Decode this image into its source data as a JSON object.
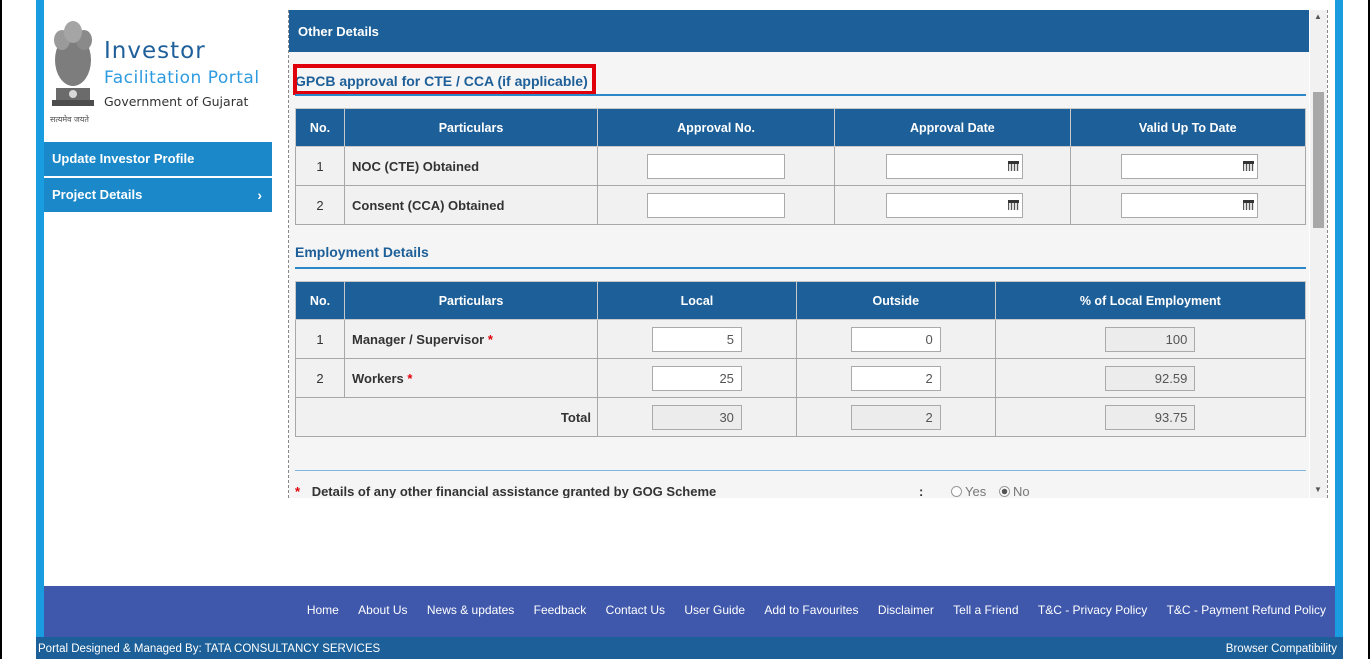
{
  "logo": {
    "line1": "Investor",
    "line2": "Facilitation Portal",
    "line3": "Government of Gujarat",
    "motto": "सत्यमेव जयते"
  },
  "sidebar": {
    "items": [
      {
        "label": "Update Investor Profile",
        "chevron": ""
      },
      {
        "label": "Project Details",
        "chevron": "›"
      }
    ]
  },
  "panel": {
    "title": "Other Details",
    "gpcb": {
      "title": "GPCB approval for CTE / CCA (if applicable)",
      "headers": [
        "No.",
        "Particulars",
        "Approval No.",
        "Approval Date",
        "Valid Up To Date"
      ],
      "rows": [
        {
          "no": "1",
          "label": "NOC (CTE) Obtained",
          "approval_no": "",
          "approval_date": "",
          "valid_date": ""
        },
        {
          "no": "2",
          "label": "Consent (CCA) Obtained",
          "approval_no": "",
          "approval_date": "",
          "valid_date": ""
        }
      ]
    },
    "employment": {
      "title": "Employment Details",
      "headers": [
        "No.",
        "Particulars",
        "Local",
        "Outside",
        "% of Local Employment"
      ],
      "rows": [
        {
          "no": "1",
          "label": "Manager / Supervisor",
          "local": "5",
          "outside": "0",
          "pct": "100"
        },
        {
          "no": "2",
          "label": "Workers",
          "local": "25",
          "outside": "2",
          "pct": "92.59"
        }
      ],
      "total": {
        "label": "Total",
        "local": "30",
        "outside": "2",
        "pct": "93.75"
      },
      "required_mark": "*"
    },
    "financial": {
      "star": "*",
      "label": "Details of any other financial assistance granted by GOG Scheme",
      "colon": ":",
      "yes": "Yes",
      "no": "No",
      "selected": "No"
    }
  },
  "footer": {
    "links": [
      "Home",
      "About Us",
      "News & updates",
      "Feedback",
      "Contact Us",
      "User Guide",
      "Add to Favourites",
      "Disclaimer",
      "Tell a Friend",
      "T&C - Privacy Policy",
      "T&C - Payment Refund Policy"
    ],
    "designed_by": "Portal Designed & Managed By: TATA CONSULTANCY SERVICES",
    "browser": "Browser Compatibility"
  },
  "colors": {
    "header_blue": "#1d5f98",
    "menu_blue": "#1a88c9",
    "accent_blue": "#1a9ce0",
    "footer_blue": "#3f58ac",
    "highlight_red": "#e0000b"
  }
}
